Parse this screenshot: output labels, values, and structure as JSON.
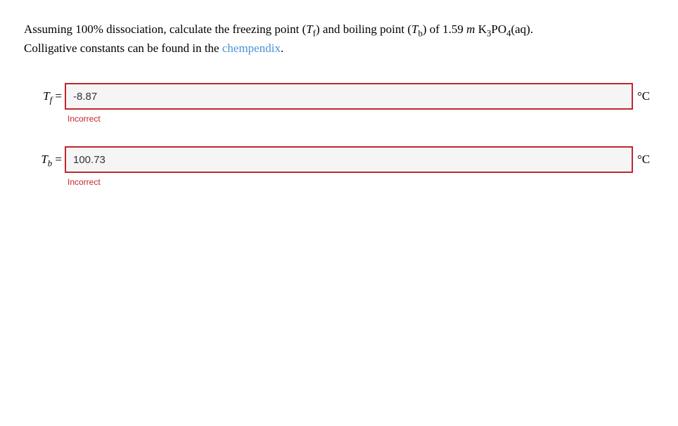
{
  "question": {
    "line1_pre": "Assuming 100% dissociation, calculate the freezing point (",
    "tf_var": "T",
    "tf_sub": "f",
    "line1_mid1": ") and boiling point (",
    "tb_var": "T",
    "tb_sub": "b",
    "line1_mid2": ") of 1.59 ",
    "m_italic": "m",
    "space": " ",
    "formula_k": "K",
    "formula_k_sub": "3",
    "formula_po": "PO",
    "formula_po_sub": "4",
    "formula_aq": "(aq).",
    "line2_pre": "Colligative constants can be found in the ",
    "link_text": "chempendix",
    "line2_post": "."
  },
  "answers": [
    {
      "var_letter": "T",
      "var_sub": "f",
      "equals": " =",
      "value": "-8.87",
      "unit": "°C",
      "feedback": "Incorrect"
    },
    {
      "var_letter": "T",
      "var_sub": "b",
      "equals": " =",
      "value": "100.73",
      "unit": "°C",
      "feedback": "Incorrect"
    }
  ]
}
